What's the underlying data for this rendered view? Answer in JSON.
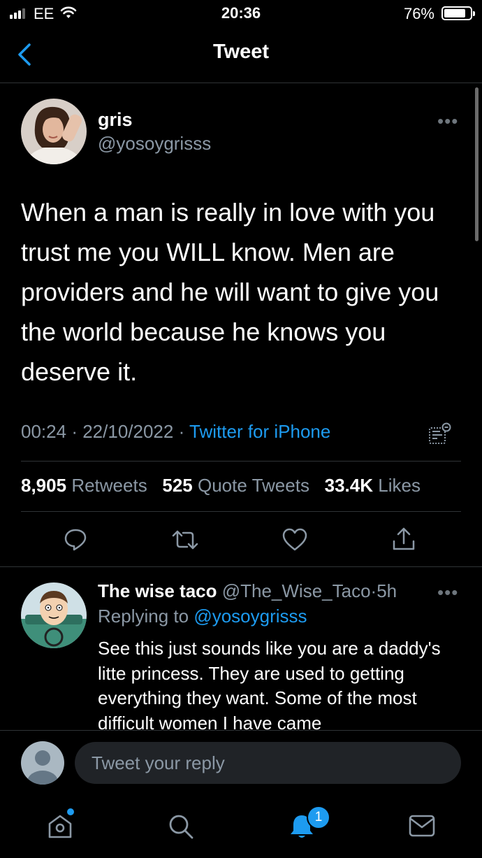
{
  "status_bar": {
    "carrier": "EE",
    "time": "20:36",
    "battery_percent_label": "76%",
    "battery_level": 0.76
  },
  "header": {
    "title": "Tweet",
    "back_icon": "chevron-left-icon"
  },
  "tweet": {
    "name": "gris",
    "handle": "@yosoygrisss",
    "text": "When a man is really in love with you trust me you WILL know. Men are providers and he will want to give you the world because he knows you deserve it.",
    "time": "00:24",
    "date": "22/10/2022",
    "source": "Twitter for iPhone",
    "separator": "·",
    "more_label": "•••",
    "retweets_count": "8,905",
    "retweets_label": "Retweets",
    "quotes_count": "525",
    "quotes_label": "Quote Tweets",
    "likes_count": "33.4K",
    "likes_label": "Likes"
  },
  "reply": {
    "name": "The wise taco",
    "handle": "@The_Wise_Taco",
    "separator": "·",
    "age": "5h",
    "replying_label": "Replying to",
    "replying_to": "@yosoygrisss",
    "text": "See this just sounds like you are a daddy's litte princess.  They are used to getting everything they want. Some of the most difficult women I have came",
    "more_label": "•••"
  },
  "composer": {
    "placeholder": "Tweet your reply"
  },
  "tab_bar": {
    "notifications_badge": "1"
  },
  "colors": {
    "background": "#000000",
    "accent": "#1d9bf0",
    "secondary_text": "#8b98a5",
    "divider": "#2f3336"
  }
}
